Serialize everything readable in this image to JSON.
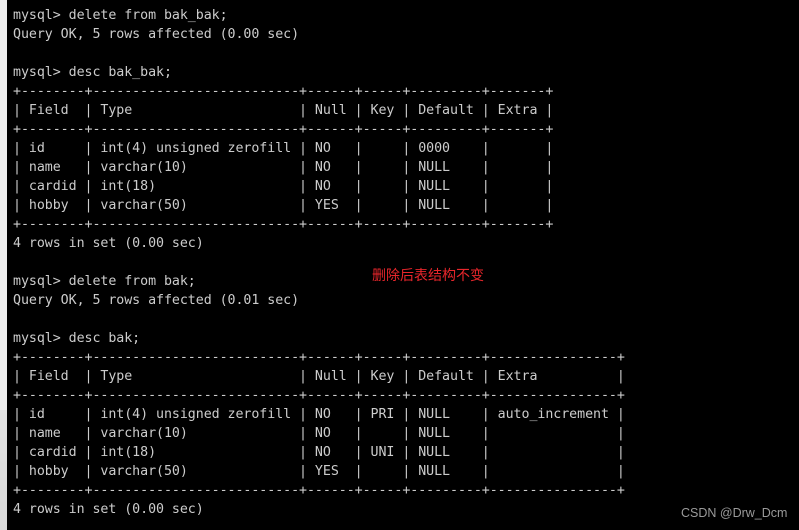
{
  "terminal": {
    "prompt": "mysql>",
    "blocks": [
      {
        "command": "delete from bak_bak;",
        "result": "Query OK, 5 rows affected (0.00 sec)"
      },
      {
        "command": "desc bak_bak;",
        "table": {
          "columns": [
            "Field",
            "Type",
            "Null",
            "Key",
            "Default",
            "Extra"
          ],
          "rows": [
            [
              "id",
              "int(4) unsigned zerofill",
              "NO",
              "",
              "0000",
              ""
            ],
            [
              "name",
              "varchar(10)",
              "NO",
              "",
              "NULL",
              ""
            ],
            [
              "cardid",
              "int(18)",
              "NO",
              "",
              "NULL",
              ""
            ],
            [
              "hobby",
              "varchar(50)",
              "YES",
              "",
              "NULL",
              ""
            ]
          ]
        },
        "result": "4 rows in set (0.00 sec)"
      },
      {
        "command": "delete from bak;",
        "result": "Query OK, 5 rows affected (0.01 sec)"
      },
      {
        "command": "desc bak;",
        "table": {
          "columns": [
            "Field",
            "Type",
            "Null",
            "Key",
            "Default",
            "Extra"
          ],
          "rows": [
            [
              "id",
              "int(4) unsigned zerofill",
              "NO",
              "PRI",
              "NULL",
              "auto_increment"
            ],
            [
              "name",
              "varchar(10)",
              "NO",
              "",
              "NULL",
              ""
            ],
            [
              "cardid",
              "int(18)",
              "NO",
              "UNI",
              "NULL",
              ""
            ],
            [
              "hobby",
              "varchar(50)",
              "YES",
              "",
              "NULL",
              ""
            ]
          ]
        },
        "result": "4 rows in set (0.00 sec)"
      }
    ]
  },
  "annotation": {
    "text": "删除后表结构不变",
    "color": "#e8262b"
  },
  "watermark": {
    "text": "CSDN @Drw_Dcm"
  },
  "colors": {
    "background": "#000000",
    "text": "#cccccc"
  }
}
